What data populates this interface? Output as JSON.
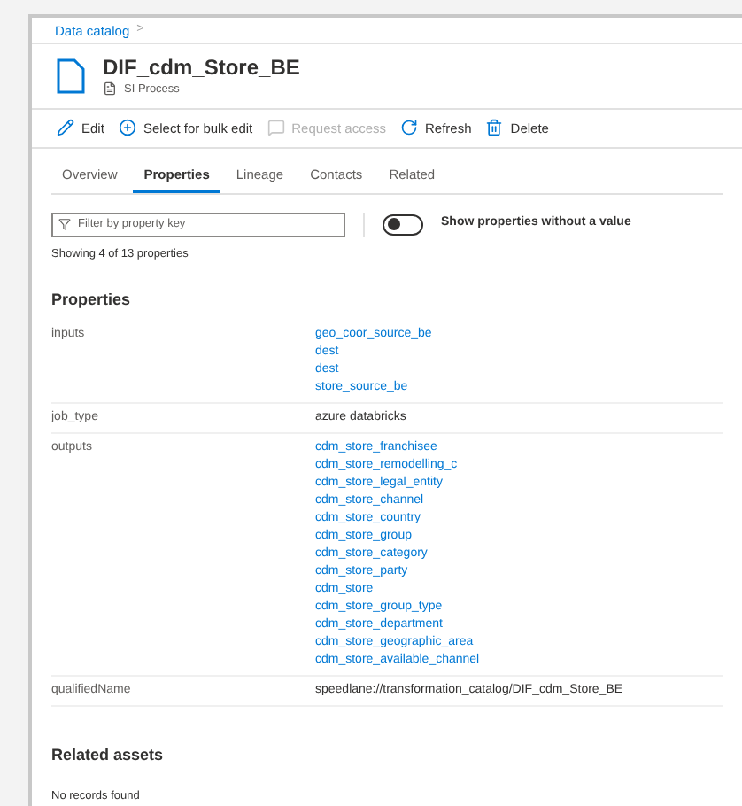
{
  "breadcrumb": [
    {
      "label": "Data catalog",
      "separator": ">"
    }
  ],
  "asset": {
    "title": "DIF_cdm_Store_BE",
    "type": "SI Process"
  },
  "toolbar": [
    {
      "label": "Edit",
      "kind": "edit",
      "disabled": false
    },
    {
      "label": "Select for bulk edit",
      "kind": "add",
      "disabled": false
    },
    {
      "label": "Request access",
      "kind": "message",
      "disabled": true
    },
    {
      "label": "Refresh",
      "kind": "refresh",
      "disabled": false
    },
    {
      "label": "Delete",
      "kind": "delete",
      "disabled": false
    }
  ],
  "tabs": [
    {
      "label": "Overview",
      "selected": false
    },
    {
      "label": "Properties",
      "selected": true
    },
    {
      "label": "Lineage",
      "selected": false
    },
    {
      "label": "Contacts",
      "selected": false
    },
    {
      "label": "Related",
      "selected": false
    }
  ],
  "filter": {
    "placeholder": "Filter by property key"
  },
  "toggle": {
    "label": "Show properties without a value",
    "on": false
  },
  "count": "Showing 4 of 13 properties",
  "properties": {
    "heading": "Properties",
    "rows": [
      {
        "key": "inputs",
        "kind": "links",
        "values": [
          "geo_coor_source_be",
          "dest",
          "dest",
          "store_source_be"
        ]
      },
      {
        "key": "job_type",
        "kind": "text",
        "values": [
          "azure databricks"
        ]
      },
      {
        "key": "outputs",
        "kind": "links",
        "values": [
          "cdm_store_franchisee",
          "cdm_store_remodelling_c",
          "cdm_store_legal_entity",
          "cdm_store_channel",
          "cdm_store_country",
          "cdm_store_group",
          "cdm_store_category",
          "cdm_store_party",
          "cdm_store",
          "cdm_store_group_type",
          "cdm_store_department",
          "cdm_store_geographic_area",
          "cdm_store_available_channel"
        ]
      },
      {
        "key": "qualifiedName",
        "kind": "text",
        "values": [
          "speedlane://transformation_catalog/DIF_cdm_Store_BE"
        ]
      }
    ]
  },
  "related": {
    "heading": "Related assets",
    "empty": "No records found"
  }
}
